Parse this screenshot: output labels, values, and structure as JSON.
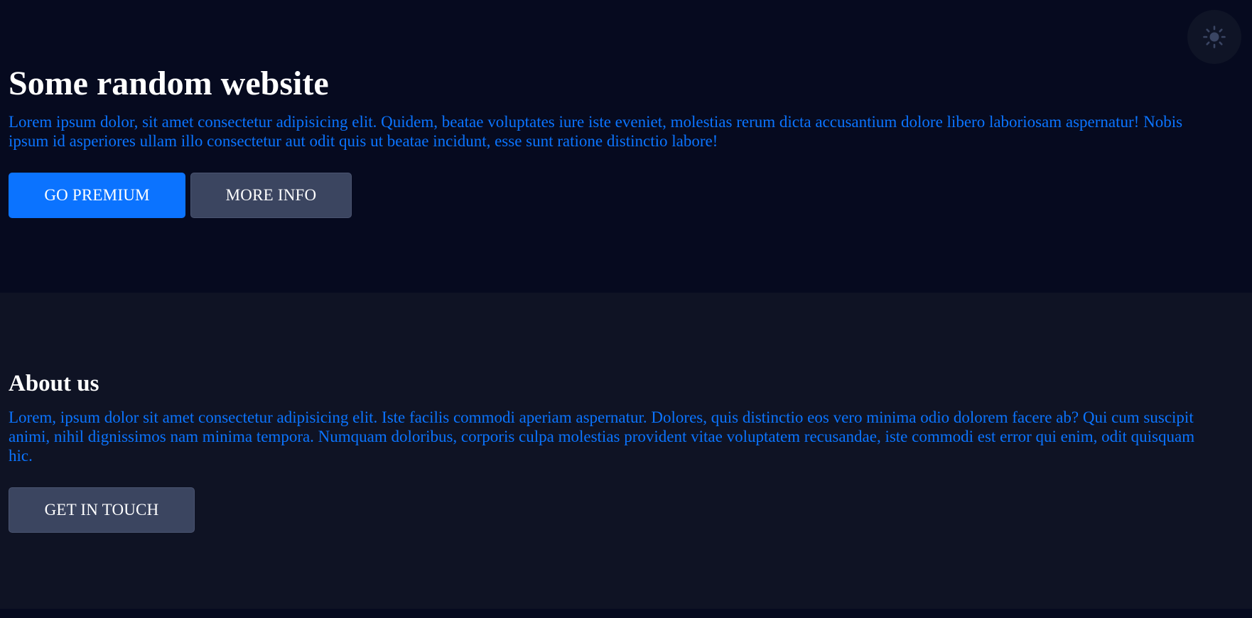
{
  "theme_toggle": {
    "icon": "sun-icon"
  },
  "hero": {
    "title": "Some random website",
    "text": "Lorem ipsum dolor, sit amet consectetur adipisicing elit. Quidem, beatae voluptates iure iste eveniet, molestias rerum dicta accusantium dolore libero laboriosam aspernatur! Nobis ipsum id asperiores ullam illo consectetur aut odit quis ut beatae incidunt, esse sunt ratione distinctio labore!",
    "primary_button": "GO PREMIUM",
    "secondary_button": "MORE INFO"
  },
  "about": {
    "title": "About us",
    "text": "Lorem, ipsum dolor sit amet consectetur adipisicing elit. Iste facilis commodi aperiam aspernatur. Dolores, quis distinctio eos vero minima odio dolorem facere ab? Qui cum suscipit animi, nihil dignissimos nam minima tempora. Numquam doloribus, corporis culpa molestias provident vitae voluptatem recusandae, iste commodi est error qui enim, odit quisquam hic.",
    "button": "GET IN TOUCH"
  },
  "colors": {
    "background": "#060a1f",
    "section_alt": "#0f1324",
    "accent": "#0b73ff",
    "secondary_button": "#3b4560",
    "heading": "#ffffff"
  }
}
